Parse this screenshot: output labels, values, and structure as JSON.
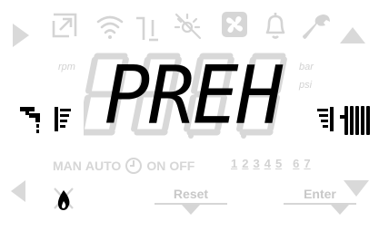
{
  "display": {
    "main_text": "PREH",
    "ghost_text": "8888"
  },
  "units": {
    "rpm": "rpm",
    "bar": "bar",
    "psi": "psi"
  },
  "modes": {
    "man": "MAN",
    "auto": "AUTO",
    "on": "ON",
    "off": "OFF"
  },
  "days": [
    "1",
    "2",
    "3",
    "4",
    "5",
    "6",
    "7"
  ],
  "buttons": {
    "reset": "Reset",
    "enter": "Enter"
  },
  "icons": [
    "play-left-icon",
    "external-link-icon",
    "wifi-icon",
    "chimney-probe-icon",
    "no-sun-icon",
    "fan-icon",
    "bell-icon",
    "wrench-icon",
    "up-arrow-icon",
    "tap-icon",
    "flame-bars-icon",
    "radiator-bars-icon",
    "radiator-icon",
    "clock-icon",
    "left-arrow-icon",
    "flame-crossed-icon",
    "down-arrow-icon"
  ],
  "colors": {
    "active": "#000000",
    "inactive": "#d9d9d9"
  }
}
